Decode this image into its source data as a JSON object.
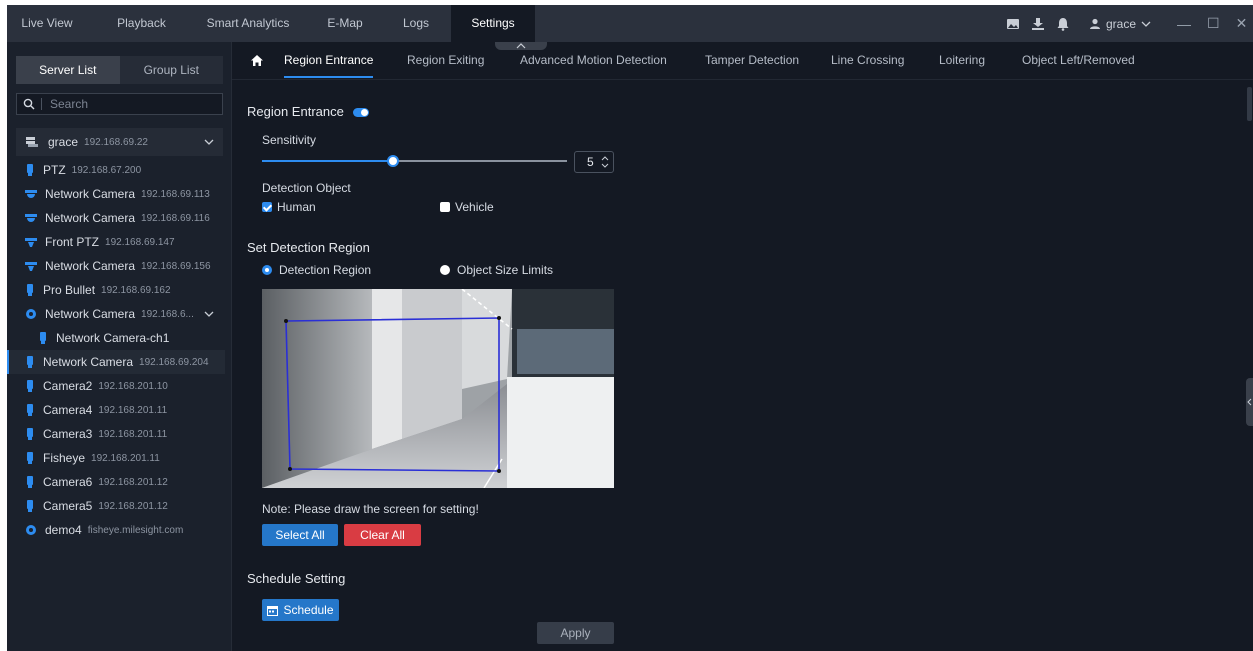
{
  "topbar": {
    "tabs": [
      "Live View",
      "Playback",
      "Smart Analytics",
      "E-Map",
      "Logs",
      "Settings"
    ],
    "active_tab": "Settings",
    "user": "grace"
  },
  "left_panel": {
    "tabs": [
      "Server List",
      "Group List"
    ],
    "active_tab": "Server List",
    "search_placeholder": "Search",
    "server": {
      "name": "grace",
      "ip": "192.168.69.22"
    },
    "devices": [
      {
        "name": "PTZ",
        "ip": "192.168.67.200",
        "icon": "ptz-icon"
      },
      {
        "name": "Network Camera",
        "ip": "192.168.69.113",
        "icon": "dome-camera-icon"
      },
      {
        "name": "Network Camera",
        "ip": "192.168.69.116",
        "icon": "dome-camera-icon"
      },
      {
        "name": "Front PTZ",
        "ip": "192.168.69.147",
        "icon": "speed-dome-icon"
      },
      {
        "name": "Network Camera",
        "ip": "192.168.69.156",
        "icon": "speed-dome-icon"
      },
      {
        "name": "Pro Bullet",
        "ip": "192.168.69.162",
        "icon": "bullet-camera-icon"
      },
      {
        "name": "Network Camera",
        "ip": "192.168.6...",
        "icon": "nvr-icon",
        "expandable": true
      },
      {
        "name": "Network Camera-ch1",
        "ip": "",
        "icon": "bullet-camera-icon",
        "child": true
      },
      {
        "name": "Network Camera",
        "ip": "192.168.69.204",
        "icon": "bullet-camera-icon",
        "selected": true
      },
      {
        "name": "Camera2",
        "ip": "192.168.201.10",
        "icon": "bullet-camera-icon"
      },
      {
        "name": "Camera4",
        "ip": "192.168.201.11",
        "icon": "bullet-camera-icon"
      },
      {
        "name": "Camera3",
        "ip": "192.168.201.11",
        "icon": "bullet-camera-icon"
      },
      {
        "name": "Fisheye",
        "ip": "192.168.201.11",
        "icon": "bullet-camera-icon"
      },
      {
        "name": "Camera6",
        "ip": "192.168.201.12",
        "icon": "bullet-camera-icon"
      },
      {
        "name": "Camera5",
        "ip": "192.168.201.12",
        "icon": "bullet-camera-icon"
      },
      {
        "name": "demo4",
        "ip": "fisheye.milesight.com",
        "icon": "fisheye-icon"
      }
    ]
  },
  "subtabs": {
    "items": [
      "Region Entrance",
      "Region Exiting",
      "Advanced Motion Detection",
      "Tamper Detection",
      "Line Crossing",
      "Loitering",
      "Object Left/Removed"
    ],
    "active": "Region Entrance"
  },
  "content": {
    "title": "Region Entrance",
    "enabled": true,
    "sensitivity_label": "Sensitivity",
    "sensitivity_value": "5",
    "sensitivity_level": 0.43,
    "detection_object_label": "Detection Object",
    "human_label": "Human",
    "human_checked": true,
    "vehicle_label": "Vehicle",
    "vehicle_checked": false,
    "set_region_title": "Set Detection Region",
    "radio_detection_region": "Detection Region",
    "radio_object_size": "Object Size Limits",
    "note": "Note: Please draw the screen for setting!",
    "select_all": "Select All",
    "clear_all": "Clear All",
    "schedule_title": "Schedule Setting",
    "schedule_button": "Schedule",
    "apply_button": "Apply"
  },
  "colors": {
    "accent": "#2d8cf0",
    "danger": "#d93c43",
    "background": "#141923",
    "panel": "#1b212c"
  }
}
